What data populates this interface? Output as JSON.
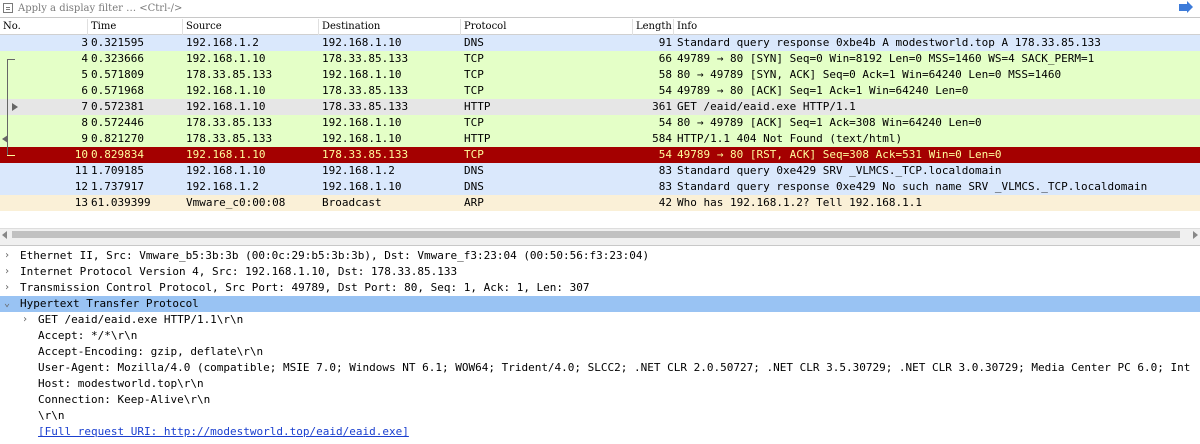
{
  "filter": {
    "placeholder": "Apply a display filter … <Ctrl-/>"
  },
  "columns": {
    "no": "No.",
    "time": "Time",
    "source": "Source",
    "destination": "Destination",
    "protocol": "Protocol",
    "length": "Length",
    "info": "Info"
  },
  "packets": [
    {
      "no": "3",
      "time": "0.321595",
      "src": "192.168.1.2",
      "dst": "192.168.1.10",
      "proto": "DNS",
      "len": "91",
      "info": "Standard query response 0xbe4b A modestworld.top A 178.33.85.133",
      "bg": "#dae8fc",
      "fg": "#000000"
    },
    {
      "no": "4",
      "time": "0.323666",
      "src": "192.168.1.10",
      "dst": "178.33.85.133",
      "proto": "TCP",
      "len": "66",
      "info": "49789 → 80 [SYN] Seq=0 Win=8192 Len=0 MSS=1460 WS=4 SACK_PERM=1",
      "bg": "#e4ffc7",
      "fg": "#000000"
    },
    {
      "no": "5",
      "time": "0.571809",
      "src": "178.33.85.133",
      "dst": "192.168.1.10",
      "proto": "TCP",
      "len": "58",
      "info": "80 → 49789 [SYN, ACK] Seq=0 Ack=1 Win=64240 Len=0 MSS=1460",
      "bg": "#e4ffc7",
      "fg": "#000000"
    },
    {
      "no": "6",
      "time": "0.571968",
      "src": "192.168.1.10",
      "dst": "178.33.85.133",
      "proto": "TCP",
      "len": "54",
      "info": "49789 → 80 [ACK] Seq=1 Ack=1 Win=64240 Len=0",
      "bg": "#e4ffc7",
      "fg": "#000000"
    },
    {
      "no": "7",
      "time": "0.572381",
      "src": "192.168.1.10",
      "dst": "178.33.85.133",
      "proto": "HTTP",
      "len": "361",
      "info": "GET /eaid/eaid.exe HTTP/1.1",
      "bg": "#e6e6e6",
      "fg": "#000000"
    },
    {
      "no": "8",
      "time": "0.572446",
      "src": "178.33.85.133",
      "dst": "192.168.1.10",
      "proto": "TCP",
      "len": "54",
      "info": "80 → 49789 [ACK] Seq=1 Ack=308 Win=64240 Len=0",
      "bg": "#e4ffc7",
      "fg": "#000000"
    },
    {
      "no": "9",
      "time": "0.821270",
      "src": "178.33.85.133",
      "dst": "192.168.1.10",
      "proto": "HTTP",
      "len": "584",
      "info": "HTTP/1.1 404 Not Found  (text/html)",
      "bg": "#e4ffc7",
      "fg": "#000000"
    },
    {
      "no": "10",
      "time": "0.829834",
      "src": "192.168.1.10",
      "dst": "178.33.85.133",
      "proto": "TCP",
      "len": "54",
      "info": "49789 → 80 [RST, ACK] Seq=308 Ack=531 Win=0 Len=0",
      "bg": "#a40000",
      "fg": "#fffc9c"
    },
    {
      "no": "11",
      "time": "1.709185",
      "src": "192.168.1.10",
      "dst": "192.168.1.2",
      "proto": "DNS",
      "len": "83",
      "info": "Standard query 0xe429 SRV _VLMCS._TCP.localdomain",
      "bg": "#dae8fc",
      "fg": "#000000"
    },
    {
      "no": "12",
      "time": "1.737917",
      "src": "192.168.1.2",
      "dst": "192.168.1.10",
      "proto": "DNS",
      "len": "83",
      "info": "Standard query response 0xe429 No such name SRV _VLMCS._TCP.localdomain",
      "bg": "#dae8fc",
      "fg": "#000000"
    },
    {
      "no": "13",
      "time": "61.039399",
      "src": "Vmware_c0:00:08",
      "dst": "Broadcast",
      "proto": "ARP",
      "len": "42",
      "info": "Who has 192.168.1.2? Tell 192.168.1.1",
      "bg": "#faf0d7",
      "fg": "#000000"
    }
  ],
  "details": [
    {
      "indent": 0,
      "arrow": "›",
      "text": "Ethernet II, Src: Vmware_b5:3b:3b (00:0c:29:b5:3b:3b), Dst: Vmware_f3:23:04 (00:50:56:f3:23:04)",
      "selected": false,
      "link": false
    },
    {
      "indent": 0,
      "arrow": "›",
      "text": "Internet Protocol Version 4, Src: 192.168.1.10, Dst: 178.33.85.133",
      "selected": false,
      "link": false
    },
    {
      "indent": 0,
      "arrow": "›",
      "text": "Transmission Control Protocol, Src Port: 49789, Dst Port: 80, Seq: 1, Ack: 1, Len: 307",
      "selected": false,
      "link": false
    },
    {
      "indent": 0,
      "arrow": "⌄",
      "text": "Hypertext Transfer Protocol",
      "selected": true,
      "link": false
    },
    {
      "indent": 1,
      "arrow": "›",
      "text": "GET /eaid/eaid.exe HTTP/1.1\\r\\n",
      "selected": false,
      "link": false
    },
    {
      "indent": 1,
      "arrow": "",
      "text": "Accept: */*\\r\\n",
      "selected": false,
      "link": false
    },
    {
      "indent": 1,
      "arrow": "",
      "text": "Accept-Encoding: gzip, deflate\\r\\n",
      "selected": false,
      "link": false
    },
    {
      "indent": 1,
      "arrow": "",
      "text": "User-Agent: Mozilla/4.0 (compatible; MSIE 7.0; Windows NT 6.1; WOW64; Trident/4.0; SLCC2; .NET CLR 2.0.50727; .NET CLR 3.5.30729; .NET CLR 3.0.30729; Media Center PC 6.0; Int",
      "selected": false,
      "link": false
    },
    {
      "indent": 1,
      "arrow": "",
      "text": "Host: modestworld.top\\r\\n",
      "selected": false,
      "link": false
    },
    {
      "indent": 1,
      "arrow": "",
      "text": "Connection: Keep-Alive\\r\\n",
      "selected": false,
      "link": false
    },
    {
      "indent": 1,
      "arrow": "",
      "text": "\\r\\n",
      "selected": false,
      "link": false
    },
    {
      "indent": 1,
      "arrow": "",
      "text": "[Full request URI: http://modestworld.top/eaid/eaid.exe]",
      "selected": false,
      "link": true
    }
  ]
}
